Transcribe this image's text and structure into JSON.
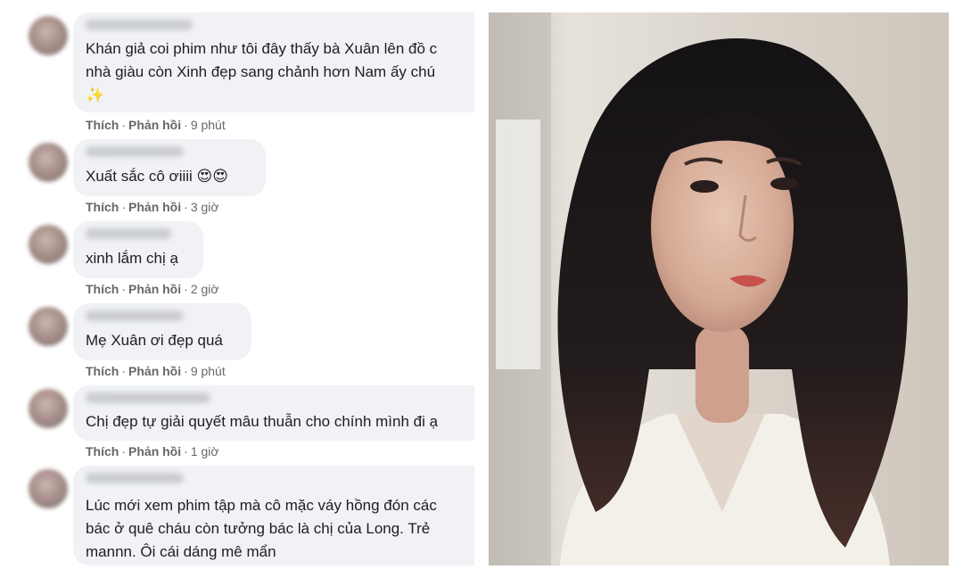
{
  "comments": [
    {
      "text": "Khán giả coi phim như tôi đây thấy bà Xuân lên đồ c\nnhà giàu còn Xinh đẹp sang chảnh hơn Nam ấy chú\n✨",
      "like": "Thích",
      "reply": "Phản hồi",
      "time": "9 phút"
    },
    {
      "text": "Xuất sắc cô ơiiii 😍😍",
      "like": "Thích",
      "reply": "Phản hồi",
      "time": "3 giờ"
    },
    {
      "text": "xinh lắm chị ạ",
      "like": "Thích",
      "reply": "Phản hồi",
      "time": "2 giờ"
    },
    {
      "text": "Mẹ Xuân ơi đẹp quá",
      "like": "Thích",
      "reply": "Phản hồi",
      "time": "9 phút"
    },
    {
      "text": "Chị đẹp tự giải quyết mâu thuẫn cho chính mình đi ạ",
      "like": "Thích",
      "reply": "Phản hồi",
      "time": "1 giờ"
    },
    {
      "text": "Lúc mới xem phim tập mà cô mặc váy hồng đón các\nbác ở quê cháu còn tưởng bác là chị của Long. Trẻ\nmannn. Ôi cái dáng mê mẩn"
    }
  ],
  "separator": "·",
  "colors": {
    "bubble": "#f0f2f5",
    "meta": "#65676b",
    "text": "#1c1e21"
  }
}
